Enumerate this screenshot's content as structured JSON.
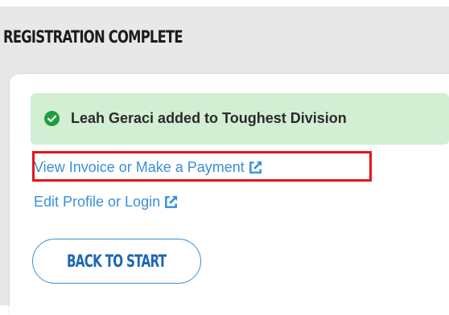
{
  "panel": {
    "title": "REGISTRATION COMPLETE"
  },
  "alert": {
    "icon": "check-circle-icon",
    "message": "Leah Geraci added to Toughest Division",
    "color": "#d2eed3",
    "icon_color": "#1f9d3f"
  },
  "links": {
    "invoice": "View Invoice or Make a Payment",
    "profile": "Edit Profile or Login",
    "icon": "external-link-icon",
    "color": "#3a8fd8"
  },
  "buttons": {
    "back_to_start": "BACK TO START"
  },
  "highlight": {
    "color": "#e8141c"
  }
}
